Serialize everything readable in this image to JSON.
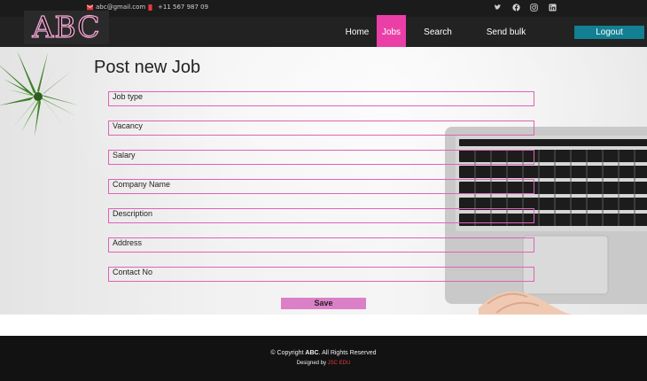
{
  "topbar": {
    "email": "abc@gmail.com",
    "phone": "+11 567 987 09",
    "social": [
      "twitter-icon",
      "facebook-icon",
      "instagram-icon",
      "linkedin-icon"
    ]
  },
  "brand": {
    "logo_text": "ABC"
  },
  "nav": {
    "items": [
      {
        "label": "Home"
      },
      {
        "label": "Jobs",
        "active": true
      },
      {
        "label": "Search users"
      },
      {
        "label": "Send bulk email"
      }
    ],
    "logout": "Logout"
  },
  "form": {
    "title": "Post new Job",
    "fields": [
      {
        "label": "Job type",
        "value": ""
      },
      {
        "label": "Vacancy",
        "value": ""
      },
      {
        "label": "Salary",
        "value": ""
      },
      {
        "label": "Company Name",
        "value": ""
      },
      {
        "label": "Description",
        "value": ""
      },
      {
        "label": "Address",
        "value": ""
      },
      {
        "label": "Contact No",
        "value": ""
      }
    ],
    "save_label": "Save"
  },
  "footer": {
    "copyright_prefix": "© Copyright ",
    "copyright_brand": "ABC",
    "copyright_suffix": ". All Rights Reserved",
    "designed_prefix": "Designed by ",
    "designed_by": "JSC EDU"
  },
  "colors": {
    "accent_pink": "#ea3fa6",
    "field_border": "#e062b8",
    "logout_bg": "#137f93",
    "save_bg": "#db7fc7"
  }
}
